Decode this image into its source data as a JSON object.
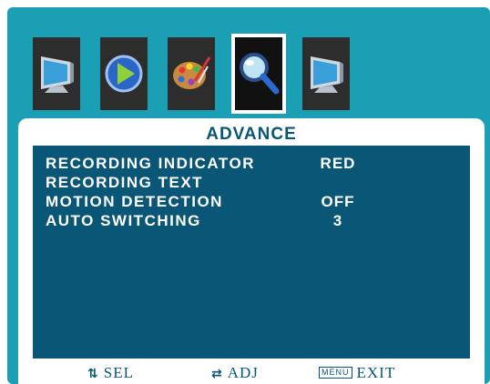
{
  "tabs": [
    {
      "icon": "monitor-icon",
      "active": false
    },
    {
      "icon": "play-icon",
      "active": false
    },
    {
      "icon": "palette-icon",
      "active": false
    },
    {
      "icon": "magnifier-icon",
      "active": true
    },
    {
      "icon": "monitor-icon",
      "active": false
    }
  ],
  "panel": {
    "title": "ADVANCE",
    "settings": [
      {
        "label": "RECORDING INDICATOR",
        "value": "RED"
      },
      {
        "label": "RECORDING TEXT",
        "value": ""
      },
      {
        "label": "MOTION DETECTION",
        "value": "OFF"
      },
      {
        "label": "AUTO SWITCHING",
        "value": "3"
      }
    ]
  },
  "footer": {
    "sel_label": "SEL",
    "adj_label": "ADJ",
    "menu_key": "MENU",
    "exit_label": "EXIT"
  },
  "colors": {
    "frame": "#1a9fb4",
    "content_bg": "#0a5676",
    "text": "#ffffff"
  }
}
